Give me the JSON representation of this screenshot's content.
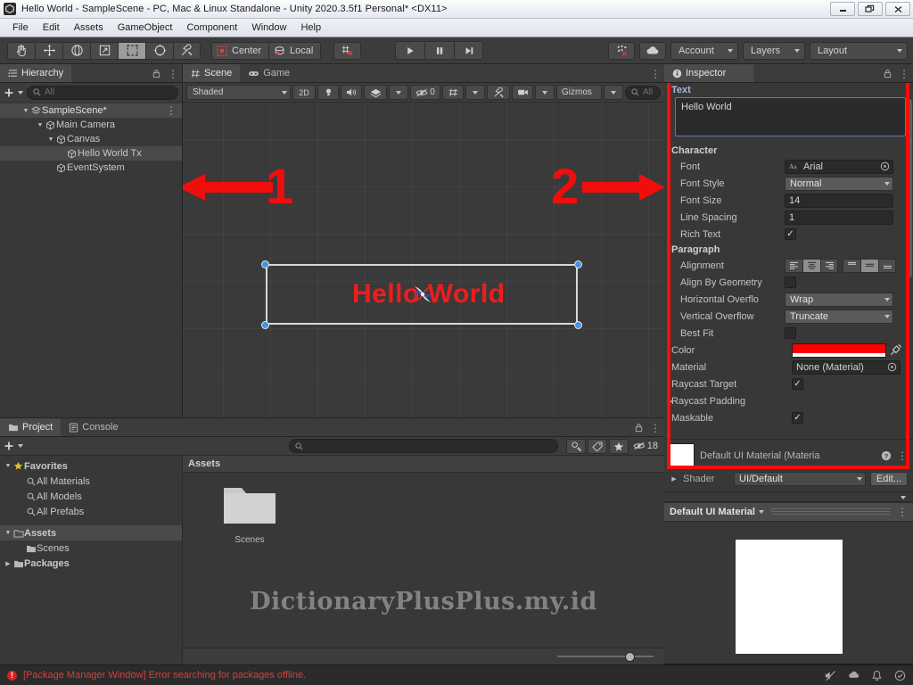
{
  "window": {
    "title": "Hello World - SampleScene - PC, Mac & Linux Standalone - Unity 2020.3.5f1 Personal* <DX11>",
    "minimize": "–",
    "restore": "❐",
    "close": "✕"
  },
  "menubar": {
    "items": [
      "File",
      "Edit",
      "Assets",
      "GameObject",
      "Component",
      "Window",
      "Help"
    ]
  },
  "toolbar": {
    "tools": [
      {
        "name": "hand-tool",
        "label": "Hand"
      },
      {
        "name": "move-tool",
        "label": "Move"
      },
      {
        "name": "rotate-tool",
        "label": "Rotate"
      },
      {
        "name": "scale-tool",
        "label": "Scale"
      },
      {
        "name": "rect-tool",
        "label": "Rect"
      },
      {
        "name": "transform-tool",
        "label": "Transform"
      },
      {
        "name": "custom-tool",
        "label": "Custom"
      }
    ],
    "pivot": "Center",
    "handle": "Local",
    "collab": "Collab",
    "cloud": "Cloud",
    "account": "Account",
    "layers": "Layers",
    "layout": "Layout"
  },
  "hierarchy": {
    "tab": "Hierarchy",
    "search_placeholder": "All",
    "items": [
      {
        "label": "SampleScene*",
        "depth": 0,
        "icon": "scene-icon",
        "selected": false
      },
      {
        "label": "Main Camera",
        "depth": 1,
        "icon": "gameobject-icon",
        "selected": false
      },
      {
        "label": "Canvas",
        "depth": 2,
        "icon": "gameobject-icon",
        "selected": false
      },
      {
        "label": "Hello World Tx",
        "depth": 3,
        "icon": "gameobject-icon",
        "selected": true
      },
      {
        "label": "EventSystem",
        "depth": 2,
        "icon": "gameobject-icon",
        "selected": false
      }
    ]
  },
  "scene": {
    "tabs": [
      "Scene",
      "Game"
    ],
    "active_tab": "Scene",
    "shading": "Shaded",
    "mode_2d": "2D",
    "effects_count": "0",
    "gizmos": "Gizmos",
    "search_placeholder": "All",
    "canvas_text": "Hello World",
    "annotation_1": "1",
    "annotation_2": "2"
  },
  "inspector": {
    "tab": "Inspector",
    "text_section_label": "Text",
    "text_value": "Hello World",
    "character_label": "Character",
    "font_label": "Font",
    "font_value": "Arial",
    "font_style_label": "Font Style",
    "font_style_value": "Normal",
    "font_size_label": "Font Size",
    "font_size_value": "14",
    "line_spacing_label": "Line Spacing",
    "line_spacing_value": "1",
    "rich_text_label": "Rich Text",
    "rich_text_checked": true,
    "paragraph_label": "Paragraph",
    "alignment_label": "Alignment",
    "align_by_geometry_label": "Align By Geometry",
    "align_by_geometry_checked": false,
    "horizontal_overflow_label": "Horizontal Overflo",
    "horizontal_overflow_value": "Wrap",
    "vertical_overflow_label": "Vertical Overflow",
    "vertical_overflow_value": "Truncate",
    "best_fit_label": "Best Fit",
    "best_fit_checked": false,
    "color_label": "Color",
    "color_value": "#FF0000",
    "material_label": "Material",
    "material_value": "None (Material)",
    "raycast_target_label": "Raycast Target",
    "raycast_target_checked": true,
    "raycast_padding_label": "Raycast Padding",
    "maskable_label": "Maskable",
    "maskable_checked": true,
    "default_material_title": "Default UI Material (Materia",
    "shader_label": "Shader",
    "shader_value": "UI/Default",
    "shader_edit": "Edit...",
    "preview_title": "Default UI Material"
  },
  "project": {
    "tabs": [
      "Project",
      "Console"
    ],
    "active_tab": "Project",
    "search_placeholder": "",
    "badge_count": "18",
    "tree": [
      {
        "label": "Favorites",
        "depth": 0,
        "icon": "star-icon",
        "selected": false,
        "expanded": true
      },
      {
        "label": "All Materials",
        "depth": 1,
        "icon": "search-icon",
        "selected": false
      },
      {
        "label": "All Models",
        "depth": 1,
        "icon": "search-icon",
        "selected": false
      },
      {
        "label": "All Prefabs",
        "depth": 1,
        "icon": "search-icon",
        "selected": false
      },
      {
        "label": "Assets",
        "depth": 0,
        "icon": "folder-icon",
        "selected": true,
        "expanded": true
      },
      {
        "label": "Scenes",
        "depth": 1,
        "icon": "folder-icon",
        "selected": false
      },
      {
        "label": "Packages",
        "depth": 0,
        "icon": "folder-icon",
        "selected": false,
        "expanded": false
      }
    ],
    "breadcrumb": "Assets",
    "folders": [
      {
        "label": "Scenes"
      }
    ],
    "watermark": "DictionaryPlusPlus.my.id"
  },
  "status": {
    "message": "[Package Manager Window] Error searching for packages offline."
  }
}
